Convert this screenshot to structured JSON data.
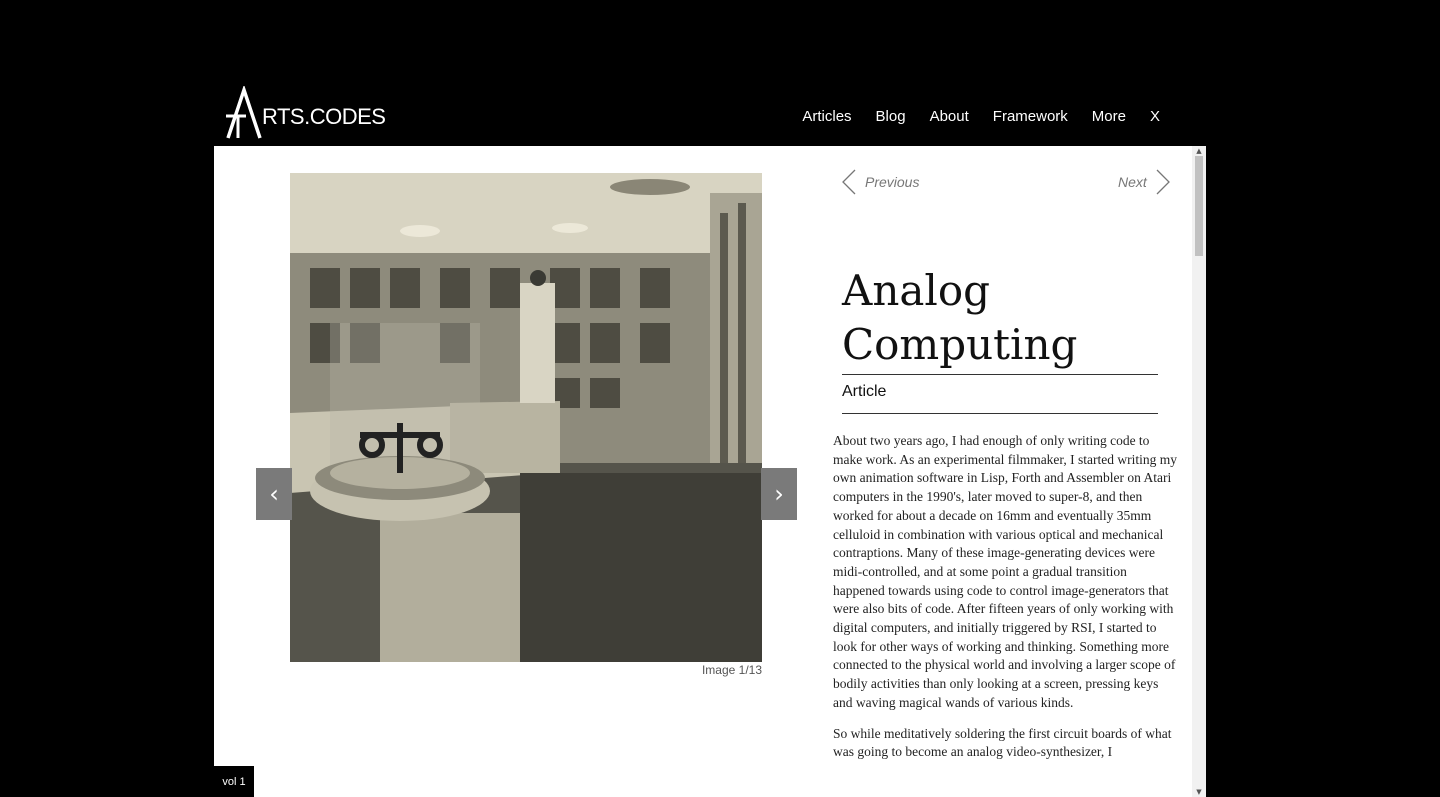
{
  "brand": {
    "logo_letter": "A",
    "logo_text": "RTS.CODES"
  },
  "nav": {
    "items": [
      "Articles",
      "Blog",
      "About",
      "Framework",
      "More",
      "X"
    ]
  },
  "gallery": {
    "prev_arrow": "‹",
    "next_arrow": "›",
    "caption": "Image 1/13"
  },
  "pager": {
    "previous": "Previous",
    "next": "Next"
  },
  "article": {
    "title_line1": "Analog",
    "title_line2": "Computing",
    "type": "Article",
    "paragraphs": [
      "About two years ago, I had enough of only writing code to make work. As an experimental filmmaker, I started writing my own animation software in Lisp, Forth and Assembler on Atari computers in the 1990's, later moved to super-8, and then worked for about a decade on 16mm and eventually 35mm celluloid in combination with various optical and mechanical contraptions. Many of these image-generating devices were midi-controlled, and at some point a gradual transition happened towards using code to control image-generators that were also bits of code. After fifteen years of only working with digital computers, and initially triggered by RSI, I started to look for other ways of working and thinking. Something more connected to the physical world and involving a larger scope of bodily activities than only looking at a screen, pressing keys and waving magical wands of various kinds.",
      "So while meditatively soldering the first circuit boards of what was going to become an analog video-synthesizer, I"
    ]
  },
  "footer": {
    "volume": "vol 1"
  }
}
